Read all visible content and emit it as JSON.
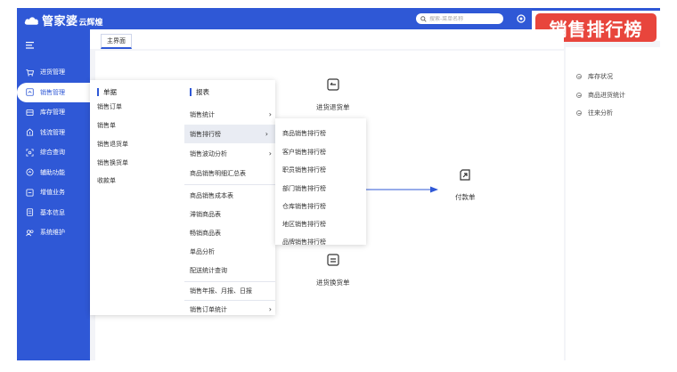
{
  "app": {
    "logo_text": "管家婆",
    "logo_sub": "云辉煌"
  },
  "search": {
    "placeholder": "搜索-菜单名称"
  },
  "badge": {
    "text": "销售排行榜"
  },
  "sidebar": {
    "items": [
      {
        "label": "进货管理",
        "icon": "cart-icon"
      },
      {
        "label": "销售管理",
        "icon": "sales-icon",
        "active": true
      },
      {
        "label": "库存管理",
        "icon": "warehouse-icon"
      },
      {
        "label": "钱流管理",
        "icon": "money-icon"
      },
      {
        "label": "综合查询",
        "icon": "query-icon"
      },
      {
        "label": "辅助功能",
        "icon": "assist-icon"
      },
      {
        "label": "增值业务",
        "icon": "value-icon"
      },
      {
        "label": "基本信息",
        "icon": "info-icon"
      },
      {
        "label": "系统维护",
        "icon": "system-icon"
      }
    ]
  },
  "tabs": [
    {
      "label": "主界面"
    }
  ],
  "flow": {
    "purchase_return": "进货退货单",
    "payment": "付款单",
    "purchase_exchange": "进货换货单"
  },
  "right_panel": {
    "links": [
      "库存状况",
      "商品进货统计",
      "往来分析"
    ]
  },
  "menu": {
    "docs": {
      "header": "单据",
      "items": [
        "销售订单",
        "销售单",
        "销售退货单",
        "销售换货单",
        "收款单"
      ]
    },
    "reports": {
      "header": "报表",
      "items": [
        {
          "label": "销售统计",
          "submenu": true
        },
        {
          "label": "销售排行榜",
          "submenu": true,
          "highlighted": true
        },
        {
          "label": "销售波动分析",
          "submenu": true
        },
        {
          "label": "商品销售明细汇总表",
          "submenu": false
        },
        {
          "label": "商品销售成本表",
          "submenu": false
        },
        {
          "label": "滞销商品表",
          "submenu": false
        },
        {
          "label": "畅销商品表",
          "submenu": false
        },
        {
          "label": "单品分析",
          "submenu": false
        },
        {
          "label": "配送统计查询",
          "submenu": false
        },
        {
          "label": "销售年报、月报、日报",
          "submenu": false
        },
        {
          "label": "销售订单统计",
          "submenu": true
        }
      ]
    },
    "ranking_submenu": [
      "商品销售排行榜",
      "客户销售排行榜",
      "职员销售排行榜",
      "部门销售排行榜",
      "仓库销售排行榜",
      "地区销售排行榜",
      "品牌销售排行榜"
    ]
  },
  "colors": {
    "primary": "#2f58d6",
    "badge": "#e8453c",
    "highlight": "#e9ecf3"
  }
}
